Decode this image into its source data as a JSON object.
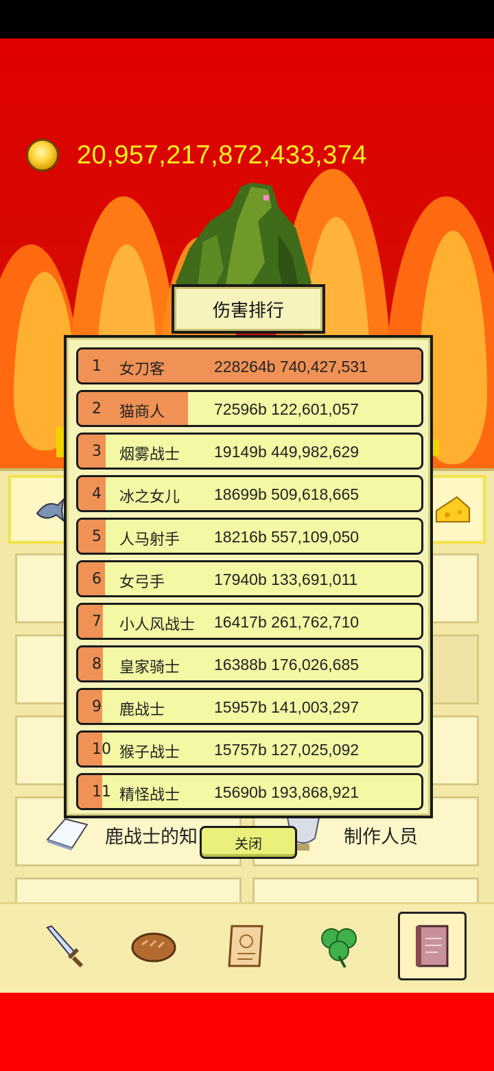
{
  "currency": {
    "amount": "20,957,217,872,433,374",
    "icon": "gold-coin-icon"
  },
  "dialog": {
    "title": "伤害排行",
    "close_label": "关闭",
    "rows": [
      {
        "rank": "1",
        "name": "女刀客",
        "score": "228264b 740,427,531",
        "bar": 1.0
      },
      {
        "rank": "2",
        "name": "猫商人",
        "score": "72596b 122,601,057",
        "bar": 0.32
      },
      {
        "rank": "3",
        "name": "烟雾战士",
        "score": "19149b 449,982,629",
        "bar": 0.08
      },
      {
        "rank": "4",
        "name": "冰之女儿",
        "score": "18699b 509,618,665",
        "bar": 0.08
      },
      {
        "rank": "5",
        "name": "人马射手",
        "score": "18216b 557,109,050",
        "bar": 0.08
      },
      {
        "rank": "6",
        "name": "女弓手",
        "score": "17940b 133,691,011",
        "bar": 0.078
      },
      {
        "rank": "7",
        "name": "小人风战士",
        "score": "16417b 261,762,710",
        "bar": 0.072
      },
      {
        "rank": "8",
        "name": "皇家骑士",
        "score": "16388b 176,026,685",
        "bar": 0.072
      },
      {
        "rank": "9",
        "name": "鹿战士",
        "score": "15957b 141,003,297",
        "bar": 0.07
      },
      {
        "rank": "10",
        "name": "猴子战士",
        "score": "15757b 127,025,092",
        "bar": 0.069
      },
      {
        "rank": "11",
        "name": "精怪战士",
        "score": "15690b 193,868,921",
        "bar": 0.069
      }
    ]
  },
  "menu": {
    "knowledge_label": "鹿战士的知",
    "credits_label": "制作人员"
  },
  "bottom_nav": [
    {
      "icon": "sword-icon"
    },
    {
      "icon": "bread-icon"
    },
    {
      "icon": "scroll-icon"
    },
    {
      "icon": "clover-icon"
    },
    {
      "icon": "book-icon",
      "active": true
    }
  ]
}
